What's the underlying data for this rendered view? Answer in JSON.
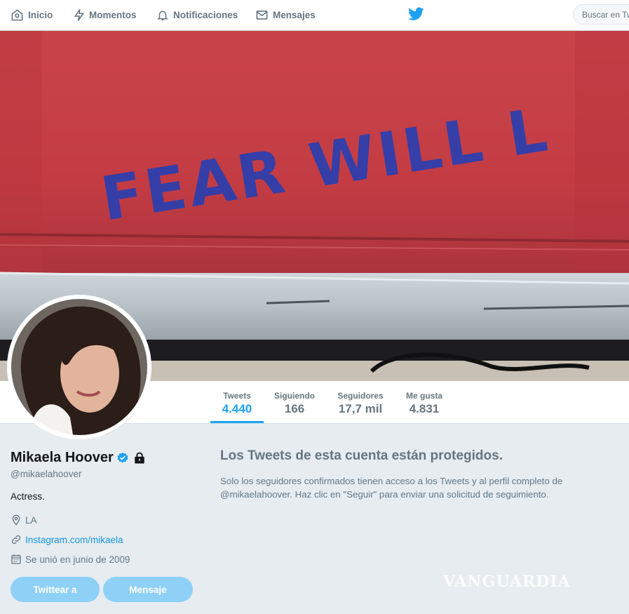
{
  "nav": {
    "items": [
      {
        "label": "Inicio",
        "icon": "home-icon"
      },
      {
        "label": "Momentos",
        "icon": "lightning-icon"
      },
      {
        "label": "Notificaciones",
        "icon": "bell-icon"
      },
      {
        "label": "Mensajes",
        "icon": "envelope-icon"
      }
    ],
    "search_placeholder": "Buscar en Tw"
  },
  "banner": {
    "graffiti_text": "FEAR WILL L"
  },
  "stats": [
    {
      "label": "Tweets",
      "value": "4.440",
      "active": true
    },
    {
      "label": "Siguiendo",
      "value": "166",
      "active": false
    },
    {
      "label": "Seguidores",
      "value": "17,7 mil",
      "active": false
    },
    {
      "label": "Me gusta",
      "value": "4.831",
      "active": false
    }
  ],
  "profile": {
    "name": "Mikaela Hoover",
    "handle": "@mikaelahoover",
    "bio": "Actress.",
    "location": "LA",
    "link": "Instagram.com/mikaela",
    "joined": "Se unió en junio de 2009",
    "verified_icon": "verified-badge-icon",
    "protected_icon": "lock-icon"
  },
  "actions": {
    "tweet_to": "Twittear a",
    "message": "Mensaje"
  },
  "protected": {
    "title": "Los Tweets de esta cuenta están protegidos.",
    "text": "Solo los seguidores confirmados tienen acceso a los Tweets y al perfil completo de @mikaelahoover. Haz clic en \"Seguir\" para enviar una solicitud de seguimiento."
  },
  "watermark": "VANGUARDIA",
  "colors": {
    "accent": "#1da1f2",
    "button": "#8fd0f7",
    "background": "#e6ecf0"
  }
}
